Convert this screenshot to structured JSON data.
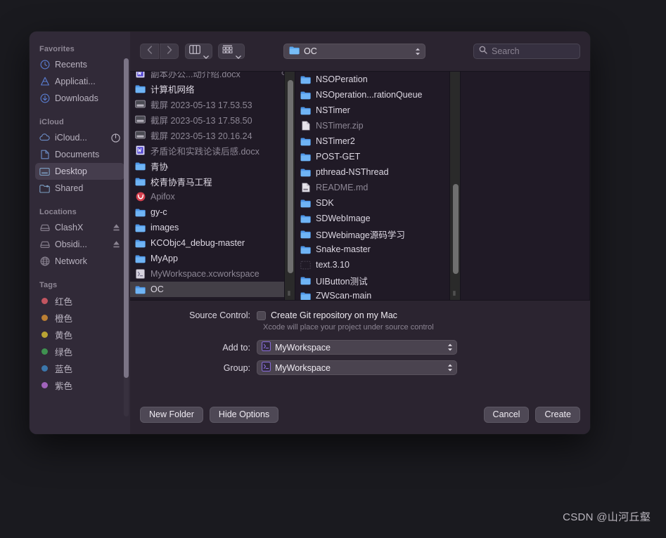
{
  "sidebar": {
    "sections": [
      {
        "header": "Favorites",
        "items": [
          {
            "label": "Recents",
            "icon": "clock-icon",
            "selected": false
          },
          {
            "label": "Applicati...",
            "icon": "applications-icon",
            "selected": false
          },
          {
            "label": "Downloads",
            "icon": "download-icon",
            "selected": false
          }
        ]
      },
      {
        "header": "iCloud",
        "items": [
          {
            "label": "iCloud...",
            "icon": "icloud-icon",
            "selected": false,
            "trailing": "progress-icon"
          },
          {
            "label": "Documents",
            "icon": "document-icon",
            "selected": false
          },
          {
            "label": "Desktop",
            "icon": "desktop-icon",
            "selected": true
          },
          {
            "label": "Shared",
            "icon": "shared-folder-icon",
            "selected": false
          }
        ]
      },
      {
        "header": "Locations",
        "items": [
          {
            "label": "ClashX",
            "icon": "disk-icon",
            "selected": false,
            "trailing": "eject-icon"
          },
          {
            "label": "Obsidi...",
            "icon": "disk-icon",
            "selected": false,
            "trailing": "eject-icon"
          },
          {
            "label": "Network",
            "icon": "network-globe-icon",
            "selected": false
          }
        ]
      },
      {
        "header": "Tags",
        "items": [
          {
            "label": "红色",
            "icon": "tag-dot",
            "color": "#c25560",
            "selected": false
          },
          {
            "label": "橙色",
            "icon": "tag-dot",
            "color": "#bb7f33",
            "selected": false
          },
          {
            "label": "黄色",
            "icon": "tag-dot",
            "color": "#b9a433",
            "selected": false
          },
          {
            "label": "绿色",
            "icon": "tag-dot",
            "color": "#3f9150",
            "selected": false
          },
          {
            "label": "蓝色",
            "icon": "tag-dot",
            "color": "#3b76ab",
            "selected": false
          },
          {
            "label": "紫色",
            "icon": "tag-dot",
            "color": "#a063bb",
            "selected": false
          }
        ]
      }
    ]
  },
  "toolbar": {
    "back_icon": "chevron-left-icon",
    "forward_icon": "chevron-right-icon",
    "view_mode_icon": "column-view-icon",
    "group_by_icon": "group-by-icon",
    "path_label": "OC",
    "path_icon": "folder-icon",
    "search_placeholder": "Search",
    "search_value": "",
    "search_icon": "search-icon"
  },
  "browser": {
    "columns": [
      {
        "name": "column-1",
        "items": [
          {
            "label": "副本办公...动介绍.docx",
            "icon": "word-doc-icon",
            "dim": true,
            "arrow": false,
            "trailing": "cloud-icon",
            "clipped": true
          },
          {
            "label": "计算机网络",
            "icon": "folder-icon",
            "dim": false,
            "arrow": true
          },
          {
            "label": "截屏 2023-05-13 17.53.53",
            "icon": "image-icon",
            "dim": true,
            "arrow": false
          },
          {
            "label": "截屏 2023-05-13 17.58.50",
            "icon": "image-icon",
            "dim": true,
            "arrow": false
          },
          {
            "label": "截屏 2023-05-13 20.16.24",
            "icon": "image-icon",
            "dim": true,
            "arrow": false
          },
          {
            "label": "矛盾论和实践论读后感.docx",
            "icon": "word-doc-icon",
            "dim": true,
            "arrow": false
          },
          {
            "label": "青协",
            "icon": "folder-icon",
            "dim": false,
            "arrow": true
          },
          {
            "label": "校青协青马工程",
            "icon": "folder-icon",
            "dim": false,
            "arrow": true
          },
          {
            "label": "Apifox",
            "icon": "apifox-icon",
            "dim": true,
            "arrow": false
          },
          {
            "label": "gy-c",
            "icon": "folder-icon",
            "dim": false,
            "arrow": true
          },
          {
            "label": "images",
            "icon": "folder-icon",
            "dim": false,
            "arrow": true
          },
          {
            "label": "KCObjc4_debug-master",
            "icon": "folder-icon",
            "dim": false,
            "arrow": true
          },
          {
            "label": "MyApp",
            "icon": "folder-icon",
            "dim": false,
            "arrow": true
          },
          {
            "label": "MyWorkspace.xcworkspace",
            "icon": "xcworkspace-icon",
            "dim": true,
            "arrow": false
          },
          {
            "label": "OC",
            "icon": "folder-icon",
            "dim": false,
            "arrow": true,
            "selected": true
          }
        ]
      },
      {
        "name": "column-2",
        "items": [
          {
            "label": "NSOPeration",
            "icon": "folder-icon",
            "dim": false,
            "arrow": true
          },
          {
            "label": "NSOperation...rationQueue",
            "icon": "folder-icon",
            "dim": false,
            "arrow": true
          },
          {
            "label": "NSTimer",
            "icon": "folder-icon",
            "dim": false,
            "arrow": true
          },
          {
            "label": "NSTimer.zip",
            "icon": "file-icon",
            "dim": true,
            "arrow": false
          },
          {
            "label": "NSTimer2",
            "icon": "folder-icon",
            "dim": false,
            "arrow": true
          },
          {
            "label": "POST-GET",
            "icon": "folder-icon",
            "dim": false,
            "arrow": true
          },
          {
            "label": "pthread-NSThread",
            "icon": "folder-icon",
            "dim": false,
            "arrow": true
          },
          {
            "label": "README.md",
            "icon": "markdown-file-icon",
            "dim": true,
            "arrow": false
          },
          {
            "label": "SDK",
            "icon": "folder-icon",
            "dim": false,
            "arrow": true
          },
          {
            "label": "SDWebImage",
            "icon": "folder-icon",
            "dim": false,
            "arrow": true
          },
          {
            "label": "SDWebimage源码学习",
            "icon": "folder-icon",
            "dim": false,
            "arrow": true
          },
          {
            "label": "Snake-master",
            "icon": "folder-icon",
            "dim": false,
            "arrow": true
          },
          {
            "label": "text.3.10",
            "icon": "empty-icon",
            "dim": false,
            "arrow": true
          },
          {
            "label": "UIButton测试",
            "icon": "folder-icon",
            "dim": false,
            "arrow": true
          },
          {
            "label": "ZWScan-main",
            "icon": "folder-icon",
            "dim": false,
            "arrow": true
          }
        ]
      },
      {
        "name": "column-3",
        "items": []
      }
    ]
  },
  "options": {
    "source_control_label": "Source Control:",
    "source_control_checkbox_label": "Create Git repository on my Mac",
    "source_control_checked": false,
    "source_control_hint": "Xcode will place your project under source control",
    "add_to_label": "Add to:",
    "add_to_value": "MyWorkspace",
    "group_label": "Group:",
    "group_value": "MyWorkspace",
    "popup_icon": "xcworkspace-icon"
  },
  "footer": {
    "new_folder": "New Folder",
    "hide_options": "Hide Options",
    "cancel": "Cancel",
    "create": "Create"
  },
  "watermark": "CSDN @山河丘壑"
}
